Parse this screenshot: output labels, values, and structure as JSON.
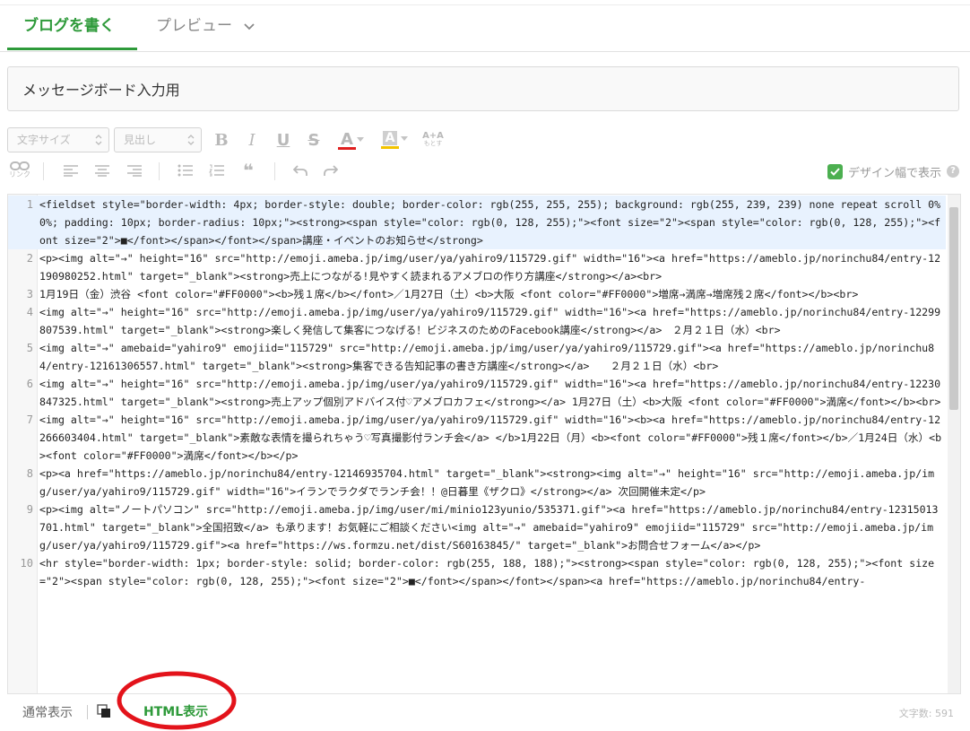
{
  "tabs": {
    "write": "ブログを書く",
    "preview": "プレビュー"
  },
  "title": {
    "value": "メッセージボード入力用"
  },
  "toolbar": {
    "font_size": "文字サイズ",
    "heading": "見出し",
    "bold": "B",
    "italic": "I",
    "underline": "U",
    "strike": "S",
    "font_color": "A",
    "bg_color": "A",
    "font_scale": "A+A",
    "font_scale_sub": "もとす",
    "link_label": "リンク",
    "quote": "❝",
    "design_width": "デザイン幅で表示",
    "help": "?"
  },
  "colors": {
    "accent": "#2e9a3a",
    "font_color_bar": "#e02020",
    "bg_color_bar": "#f3c400",
    "check": "#4caf50",
    "annotation": "#e3131b"
  },
  "code": {
    "line_numbers": [
      "1",
      "2",
      "3",
      "4",
      "5",
      "6",
      "7",
      "8",
      "9",
      "10"
    ],
    "lines": [
      "<fieldset style=\"border-width: 4px; border-style: double; border-color: rgb(255, 255, 255); background: rgb(255, 239, 239) none repeat scroll 0% 0%; padding: 10px; border-radius: 10px;\"><strong><span style=\"color: rgb(0, 128, 255);\"><font size=\"2\"><span style=\"color: rgb(0, 128, 255);\"><font size=\"2\">■</font></span></font></span>講座・イベントのお知らせ</strong>",
      "<p><img alt=\"→\" height=\"16\" src=\"http://emoji.ameba.jp/img/user/ya/yahiro9/115729.gif\" width=\"16\"><a href=\"https://ameblo.jp/norinchu84/entry-12190980252.html\" target=\"_blank\"><strong>売上につながる!見やすく読まれるアメブロの作り方講座</strong></a><br>",
      "1月19日（金）渋谷 <font color=\"#FF0000\"><b>残１席</b></font>／1月27日（土）<b>大阪 <font color=\"#FF0000\">増席→満席→増席残２席</font></b><br>",
      "<img alt=\"→\" height=\"16\" src=\"http://emoji.ameba.jp/img/user/ya/yahiro9/115729.gif\" width=\"16\"><a href=\"https://ameblo.jp/norinchu84/entry-12299807539.html\" target=\"_blank\"><strong>楽しく発信して集客につなげる！ビジネスのためのFacebook講座</strong></a>　２月２１日（水）<br>",
      "<img alt=\"→\" amebaid=\"yahiro9\" emojiid=\"115729\" src=\"http://emoji.ameba.jp/img/user/ya/yahiro9/115729.gif\"><a href=\"https://ameblo.jp/norinchu84/entry-12161306557.html\" target=\"_blank\"><strong>集客できる告知記事の書き方講座</strong></a>　　２月２１日（水）<br>",
      "<img alt=\"→\" height=\"16\" src=\"http://emoji.ameba.jp/img/user/ya/yahiro9/115729.gif\" width=\"16\"><a href=\"https://ameblo.jp/norinchu84/entry-12230847325.html\" target=\"_blank\"><strong>売上アップ個別アドバイス付♡アメブロカフェ</strong></a> 1月27日（土）<b>大阪 <font color=\"#FF0000\">満席</font></b><br>",
      "<img alt=\"→\" height=\"16\" src=\"http://emoji.ameba.jp/img/user/ya/yahiro9/115729.gif\" width=\"16\"><b><a href=\"https://ameblo.jp/norinchu84/entry-12266603404.html\" target=\"_blank\">素敵な表情を撮られちゃう♡写真撮影付ランチ会</a> </b>1月22日（月）<b><font color=\"#FF0000\">残１席</font></b>／1月24日（水）<b><font color=\"#FF0000\">満席</font></b></p>",
      "<p><a href=\"https://ameblo.jp/norinchu84/entry-12146935704.html\" target=\"_blank\"><strong><img alt=\"→\" height=\"16\" src=\"http://emoji.ameba.jp/img/user/ya/yahiro9/115729.gif\" width=\"16\">イランでラクダでランチ会！！@日暮里《ザクロ》</strong></a> 次回開催未定</p>",
      "<p><img alt=\"ノートパソコン\" src=\"http://emoji.ameba.jp/img/user/mi/minio123yunio/535371.gif\"><a href=\"https://ameblo.jp/norinchu84/entry-12315013701.html\" target=\"_blank\">全国招致</a> も承ります！お気軽にご相談ください<img alt=\"→\" amebaid=\"yahiro9\" emojiid=\"115729\" src=\"http://emoji.ameba.jp/img/user/ya/yahiro9/115729.gif\"><a href=\"https://ws.formzu.net/dist/S60163845/\" target=\"_blank\">お問合せフォーム</a></p>",
      "<hr style=\"border-width: 1px; border-style: solid; border-color: rgb(255, 188, 188);\"><strong><span style=\"color: rgb(0, 128, 255);\"><font size=\"2\"><span style=\"color: rgb(0, 128, 255);\"><font size=\"2\">■</font></span></font></span><a href=\"https://ameblo.jp/norinchu84/entry-"
    ]
  },
  "status": {
    "normal_mode": "通常表示",
    "html_mode": "HTML表示",
    "char_count": "文字数: 591"
  }
}
